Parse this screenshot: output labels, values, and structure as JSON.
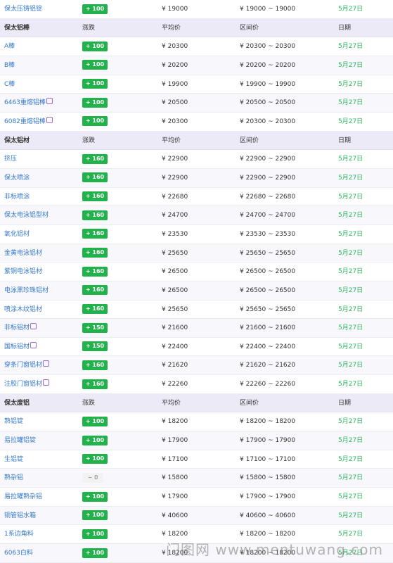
{
  "rows": [
    {
      "type": "item",
      "name": "保太压铸铝锭",
      "change": "+ 100",
      "avg": "¥ 19000",
      "range": "¥ 19000 ~ 19000",
      "date": "5月27日"
    },
    {
      "type": "header",
      "name": "保太铝棒",
      "change": "涨跌",
      "avg": "平均价",
      "range": "区间价",
      "date": "日期"
    },
    {
      "type": "item",
      "name": "A棒",
      "change": "+ 100",
      "avg": "¥ 20300",
      "range": "¥ 20300 ~ 20300",
      "date": "5月27日"
    },
    {
      "type": "item",
      "name": "B棒",
      "change": "+ 100",
      "avg": "¥ 20200",
      "range": "¥ 20200 ~ 20200",
      "date": "5月27日"
    },
    {
      "type": "item",
      "name": "C棒",
      "change": "+ 100",
      "avg": "¥ 19900",
      "range": "¥ 19900 ~ 19900",
      "date": "5月27日"
    },
    {
      "type": "item",
      "name": "6463重熔铝棒",
      "icon": "hot-icon",
      "change": "+ 100",
      "avg": "¥ 20500",
      "range": "¥ 20500 ~ 20500",
      "date": "5月27日"
    },
    {
      "type": "item",
      "name": "6082重熔铝棒",
      "icon": "hot-icon",
      "change": "+ 100",
      "avg": "¥ 20300",
      "range": "¥ 20300 ~ 20300",
      "date": "5月27日"
    },
    {
      "type": "header",
      "name": "保太铝材",
      "change": "涨跌",
      "avg": "平均价",
      "range": "区间价",
      "date": "日期"
    },
    {
      "type": "item",
      "name": "挤压",
      "change": "+ 160",
      "avg": "¥ 22900",
      "range": "¥ 22900 ~ 22900",
      "date": "5月27日"
    },
    {
      "type": "item",
      "name": "保太喷涂",
      "change": "+ 160",
      "avg": "¥ 22900",
      "range": "¥ 22900 ~ 22900",
      "date": "5月27日"
    },
    {
      "type": "item",
      "name": "非标喷涂",
      "change": "+ 160",
      "avg": "¥ 22680",
      "range": "¥ 22680 ~ 22680",
      "date": "5月27日"
    },
    {
      "type": "item",
      "name": "保太电泳铝型材",
      "change": "+ 160",
      "avg": "¥ 24700",
      "range": "¥ 24700 ~ 24700",
      "date": "5月27日"
    },
    {
      "type": "item",
      "name": "氧化铝材",
      "change": "+ 160",
      "avg": "¥ 23530",
      "range": "¥ 23530 ~ 23530",
      "date": "5月27日"
    },
    {
      "type": "item",
      "name": "金黄电泳铝材",
      "change": "+ 160",
      "avg": "¥ 25650",
      "range": "¥ 25650 ~ 25650",
      "date": "5月27日"
    },
    {
      "type": "item",
      "name": "紫铜电泳铝材",
      "change": "+ 160",
      "avg": "¥ 26500",
      "range": "¥ 26500 ~ 26500",
      "date": "5月27日"
    },
    {
      "type": "item",
      "name": "电泳黑珍珠铝材",
      "change": "+ 160",
      "avg": "¥ 26500",
      "range": "¥ 26500 ~ 26500",
      "date": "5月27日"
    },
    {
      "type": "item",
      "name": "喷涂木纹铝材",
      "change": "+ 160",
      "avg": "¥ 25650",
      "range": "¥ 25650 ~ 25650",
      "date": "5月27日"
    },
    {
      "type": "item",
      "name": "非标铝材",
      "icon": "hot-icon",
      "change": "+ 150",
      "avg": "¥ 21600",
      "range": "¥ 21600 ~ 21600",
      "date": "5月27日"
    },
    {
      "type": "item",
      "name": "国标铝材",
      "icon": "hot-icon",
      "change": "+ 150",
      "avg": "¥ 22400",
      "range": "¥ 22400 ~ 22400",
      "date": "5月27日"
    },
    {
      "type": "item",
      "name": "穿条门窗铝材",
      "icon": "hot-icon",
      "change": "+ 160",
      "avg": "¥ 21620",
      "range": "¥ 21620 ~ 21620",
      "date": "5月27日"
    },
    {
      "type": "item",
      "name": "注胶门窗铝材",
      "icon": "hot-icon",
      "change": "+ 160",
      "avg": "¥ 22260",
      "range": "¥ 22260 ~ 22260",
      "date": "5月27日"
    },
    {
      "type": "header",
      "name": "保太废铝",
      "change": "涨跌",
      "avg": "平均价",
      "range": "区间价",
      "date": "日期"
    },
    {
      "type": "item",
      "name": "熟铝锭",
      "change": "+ 100",
      "avg": "¥ 18200",
      "range": "¥ 18200 ~ 18200",
      "date": "5月27日"
    },
    {
      "type": "item",
      "name": "易拉罐铝锭",
      "change": "+ 100",
      "avg": "¥ 17900",
      "range": "¥ 17900 ~ 17900",
      "date": "5月27日"
    },
    {
      "type": "item",
      "name": "生铝锭",
      "change": "+ 100",
      "avg": "¥ 17100",
      "range": "¥ 17100 ~ 17100",
      "date": "5月27日"
    },
    {
      "type": "item",
      "name": "熟杂铝",
      "change": "~ 0",
      "flat": true,
      "avg": "¥ 15800",
      "range": "¥ 15800 ~ 15800",
      "date": "5月27日"
    },
    {
      "type": "item",
      "name": "易拉罐熟杂铝",
      "change": "+ 100",
      "avg": "¥ 17900",
      "range": "¥ 17900 ~ 17900",
      "date": "5月27日"
    },
    {
      "type": "item",
      "name": "铜管铝水箱",
      "change": "+ 100",
      "avg": "¥ 40600",
      "range": "¥ 40600 ~ 40600",
      "date": "5月27日"
    },
    {
      "type": "item",
      "name": "1系边角料",
      "change": "+ 100",
      "avg": "¥ 18200",
      "range": "¥ 18200 ~ 18200",
      "date": "5月27日"
    },
    {
      "type": "item",
      "name": "6063白料",
      "change": "+ 100",
      "avg": "¥ 18200",
      "range": "¥ 18200 ~ 18200",
      "date": "5月27日"
    }
  ],
  "watermark": "门图网 www.mentuwang.com",
  "colors": {
    "up_badge": "#22b24c",
    "date": "#2bb35a",
    "link": "#3478c8",
    "header_bg": "#eceaf6"
  }
}
